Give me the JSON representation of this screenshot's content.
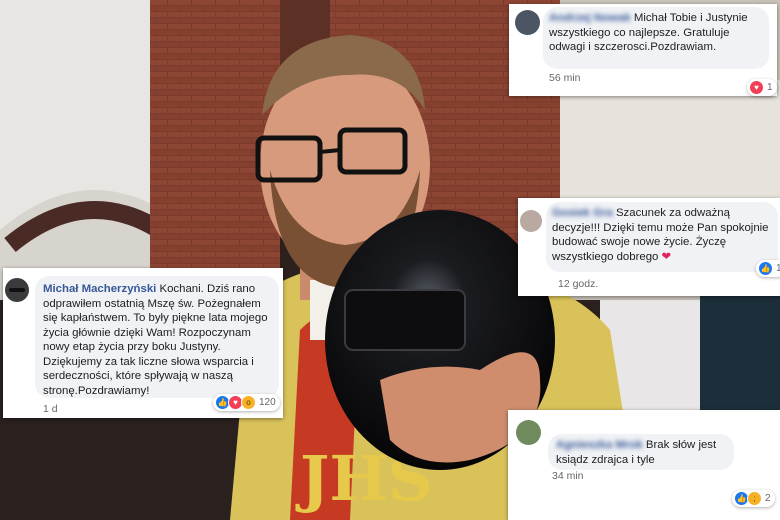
{
  "comments": [
    {
      "author": "Andrzej Nowak",
      "text": "Michał Tobie i Justynie wszystkiego co najlepsze. Gratuluje odwagi i szczerosci.Pozdrawiam.",
      "time": "56 min",
      "reactions": {
        "icons": [
          "heart-icon"
        ],
        "count": "1"
      }
    },
    {
      "author": "Gosiek Gra",
      "text": "Szacunek za odważną decyzje!!! Dzięki temu może Pan spokojnie budować swoje nowe życie. Życzę wszystkiego dobrego",
      "emoji": "❤",
      "time": "12 godz.",
      "reactions": {
        "icons": [
          "like-icon"
        ],
        "count": "1"
      }
    },
    {
      "author": "Michał Macherzyński",
      "text": "Kochani. Dziś rano odprawiłem ostatnią Mszę św. Pożegnałem się kapłaństwem. To były piękne lata mojego życia głównie dzięki Wam! Rozpoczynam nowy etap życia przy boku Justyny. Dziękujemy za tak liczne słowa wsparcia i serdeczności, które spływają w naszą stronę.Pozdrawiamy!",
      "time": "1 d",
      "reactions": {
        "icons": [
          "like-icon",
          "love-icon",
          "wow-icon"
        ],
        "count": "120"
      }
    },
    {
      "author": "Agnieszka Mrok",
      "text": "Brak słów jest ksiądz zdrajca i tyle",
      "time": "34 min",
      "reactions": {
        "icons": [
          "like-icon",
          "sad-icon"
        ],
        "count": "2"
      }
    }
  ],
  "colors": {
    "link": "#385898",
    "bubble": "#f0f2f5",
    "like": "#1877f2",
    "love": "#f33e58",
    "wow": "#f7b125"
  }
}
